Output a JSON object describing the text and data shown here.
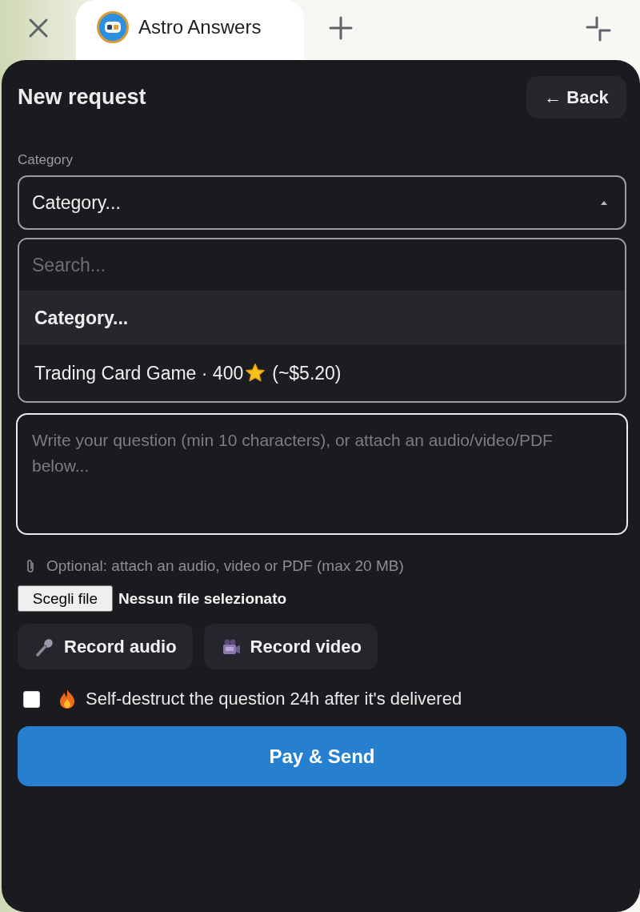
{
  "browser": {
    "tabs": [
      {
        "title": "Astro Answers",
        "selected": true
      }
    ]
  },
  "header": {
    "title": "New request",
    "back_button": "← Back"
  },
  "category": {
    "label": "Category",
    "value": "Category...",
    "expanded": true
  },
  "dropdown": {
    "search_placeholder": "Search...",
    "options": [
      {
        "label": "Category...",
        "selected": true
      },
      {
        "label": "Trading Card Game · 400",
        "price": "(~$5.20)",
        "selected": false
      }
    ]
  },
  "question": {
    "placeholder": "Write your question (min 10 characters), or attach an audio/video/PDF below..."
  },
  "attachment": {
    "hint": "Optional: attach an audio, video or PDF (max 20 MB)",
    "file_button": "Scegli file",
    "file_status": "Nessun file selezionato"
  },
  "record_buttons": [
    {
      "kind": "audio",
      "label": "Record audio"
    },
    {
      "kind": "video",
      "label": "Record video"
    }
  ],
  "self_destruct": {
    "label": "Self-destruct the question 24h after it's delivered",
    "checked": false
  },
  "submit": "Pay & Send"
}
